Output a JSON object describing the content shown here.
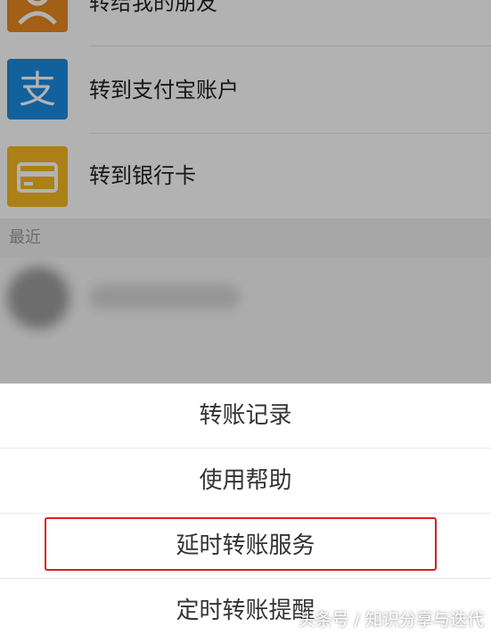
{
  "options": [
    {
      "label": "转给我的朋友",
      "icon": "friend-icon",
      "color": "#e8891f"
    },
    {
      "label": "转到支付宝账户",
      "icon": "alipay-icon",
      "color": "#1b8ce0"
    },
    {
      "label": "转到银行卡",
      "icon": "bank-card-icon",
      "color": "#f5b820"
    }
  ],
  "section_title": "最近",
  "menu": {
    "items": [
      "转账记录",
      "使用帮助",
      "延时转账服务",
      "定时转账提醒"
    ],
    "highlight_color": "#d81e1e"
  },
  "watermark": "头条号 / 知识分享与迭代"
}
